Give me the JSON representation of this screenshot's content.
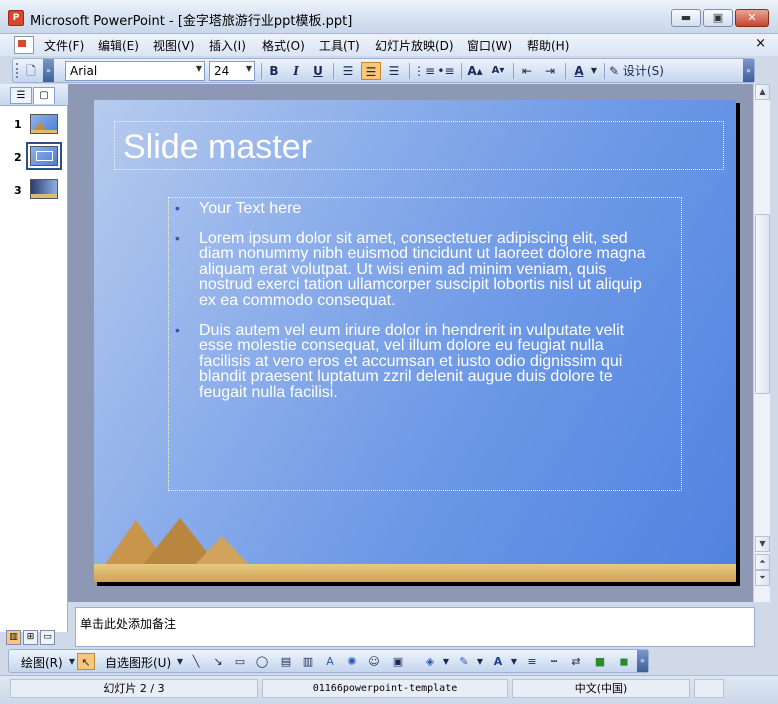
{
  "window": {
    "title": "Microsoft PowerPoint - [金字塔旅游行业ppt模板.ppt]",
    "app_icon": "P",
    "minimize_icon": "minimize-icon",
    "maximize_icon": "maximize-icon",
    "close_icon": "close-icon"
  },
  "menu": {
    "items": [
      "文件(F)",
      "编辑(E)",
      "视图(V)",
      "插入(I)",
      "格式(O)",
      "工具(T)",
      "幻灯片放映(D)",
      "窗口(W)",
      "帮助(H)"
    ],
    "close_glyph": "×"
  },
  "toolbar": {
    "font_name": "Arial",
    "font_size": "24",
    "bold": "B",
    "italic": "I",
    "underline": "U",
    "design_label": "设计(S)",
    "align_active": "center"
  },
  "thumbnails": {
    "items": [
      {
        "number": "1"
      },
      {
        "number": "2"
      },
      {
        "number": "3"
      }
    ],
    "selected": 2
  },
  "slide": {
    "title": "Slide master",
    "bullets": [
      "Your Text here",
      "Lorem ipsum dolor sit amet, consectetuer adipiscing elit, sed diam nonummy nibh euismod tincidunt ut laoreet dolore magna aliquam erat volutpat. Ut wisi enim ad minim veniam, quis nostrud exerci tation ullamcorper suscipit lobortis nisl ut aliquip ex ea commodo consequat.",
      "Duis autem vel eum iriure dolor in hendrerit in vulputate velit esse molestie consequat, vel illum dolore eu feugiat nulla facilisis at vero eros et accumsan et iusto odio dignissim qui blandit praesent luptatum zzril delenit augue duis dolore te feugait nulla facilisi."
    ],
    "bullet_glyph": "•"
  },
  "notes": {
    "placeholder": "单击此处添加备注"
  },
  "drawing_toolbar": {
    "draw_label": "绘图(R)",
    "autoshapes_label": "自选图形(U)"
  },
  "status": {
    "slide_indicator": "幻灯片 2 / 3",
    "template": "01166powerpoint-template",
    "language": "中文(中国)"
  },
  "colors": {
    "slide_accent": "#4f82e0",
    "bullet_color": "#3a56a8"
  }
}
